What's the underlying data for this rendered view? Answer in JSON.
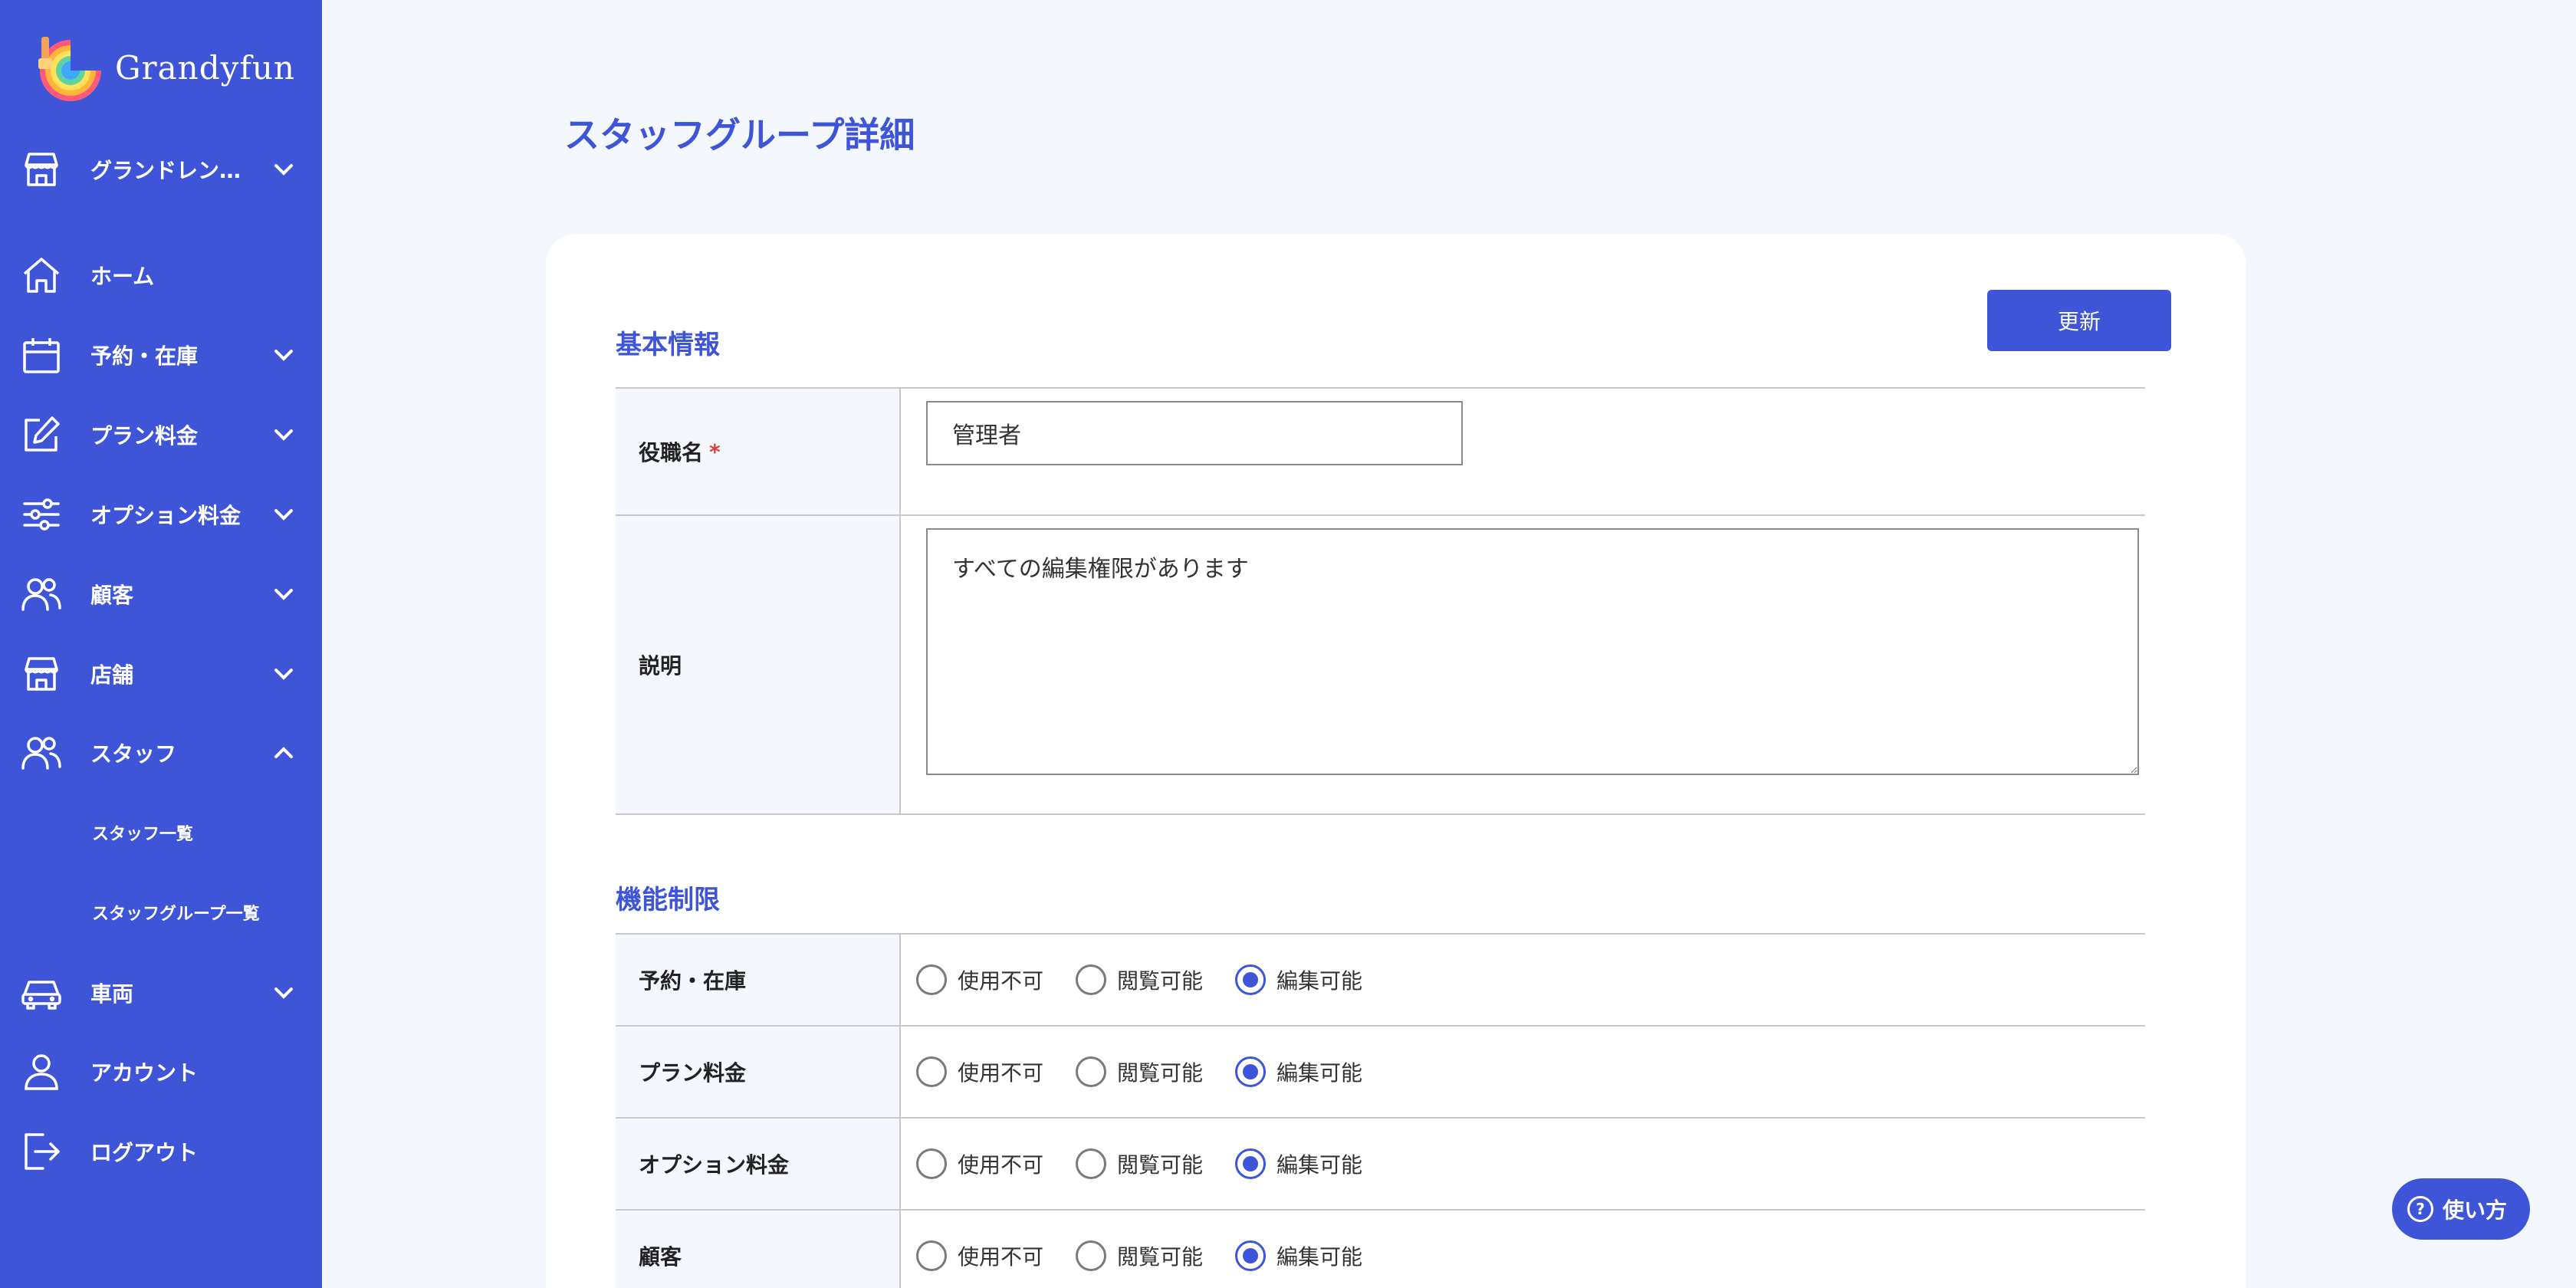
{
  "app": {
    "brand": "Grandyfun",
    "colors": {
      "primary": "#3e55d8",
      "background": "#f4f7fd",
      "required": "#e23a3a"
    }
  },
  "sidebar": {
    "store_selector": {
      "label": "グランドレン…",
      "icon": "store-icon"
    },
    "items": [
      {
        "label": "ホーム",
        "icon": "home-icon",
        "expandable": false
      },
      {
        "label": "予約・在庫",
        "icon": "calendar-icon",
        "expandable": true
      },
      {
        "label": "プラン料金",
        "icon": "edit-icon",
        "expandable": true
      },
      {
        "label": "オプション料金",
        "icon": "sliders-icon",
        "expandable": true
      },
      {
        "label": "顧客",
        "icon": "users-icon",
        "expandable": true
      },
      {
        "label": "店舗",
        "icon": "store-icon",
        "expandable": true
      },
      {
        "label": "スタッフ",
        "icon": "users-icon",
        "expandable": true,
        "expanded": true,
        "children": [
          {
            "label": "スタッフ一覧"
          },
          {
            "label": "スタッフグループ一覧"
          }
        ]
      },
      {
        "label": "車両",
        "icon": "car-icon",
        "expandable": true
      },
      {
        "label": "アカウント",
        "icon": "user-icon",
        "expandable": false
      },
      {
        "label": "ログアウト",
        "icon": "logout-icon",
        "expandable": false
      }
    ]
  },
  "page": {
    "title": "スタッフグループ詳細",
    "update_button": "更新"
  },
  "basic_info": {
    "title": "基本情報",
    "role_name": {
      "label": "役職名",
      "required_mark": "*",
      "value": "管理者"
    },
    "description": {
      "label": "説明",
      "value": "すべての編集権限があります"
    }
  },
  "permissions": {
    "title": "機能制限",
    "options": [
      "使用不可",
      "閲覧可能",
      "編集可能"
    ],
    "rows": [
      {
        "label": "予約・在庫",
        "selected": "編集可能"
      },
      {
        "label": "プラン料金",
        "selected": "編集可能"
      },
      {
        "label": "オプション料金",
        "selected": "編集可能"
      },
      {
        "label": "顧客",
        "selected": "編集可能"
      }
    ]
  },
  "help": {
    "label": "使い方",
    "icon": "question-icon"
  }
}
